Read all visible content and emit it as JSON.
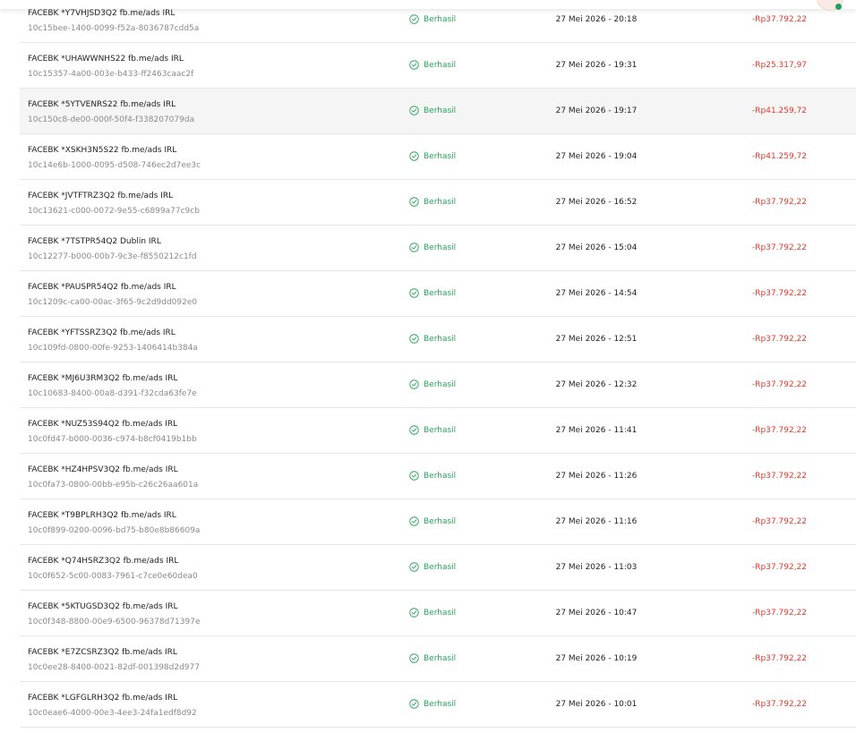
{
  "colors": {
    "success": "#27a55a",
    "negative_amount": "#e0392b",
    "row_highlight": "#f5f5f5",
    "divider": "#e7e7e7"
  },
  "icons": {
    "status": "check-circle-icon"
  },
  "transactions": [
    {
      "description": "FACEBK *Y7VHJSD3Q2 fb.me/ads IRL",
      "id": "10c15bee-1400-0099-f52a-8036787cdd5a",
      "status": "Berhasil",
      "datetime": "27 Mei 2026 - 20:18",
      "amount": "-Rp37.792,22"
    },
    {
      "description": "FACEBK *UHAWWNHS22 fb.me/ads IRL",
      "id": "10c15357-4a00-003e-b433-ff2463caac2f",
      "status": "Berhasil",
      "datetime": "27 Mei 2026 - 19:31",
      "amount": "-Rp25.317,97"
    },
    {
      "description": "FACEBK *5YTVENRS22 fb.me/ads IRL",
      "id": "10c150c8-de00-000f-50f4-f338207079da",
      "status": "Berhasil",
      "datetime": "27 Mei 2026 - 19:17",
      "amount": "-Rp41.259,72"
    },
    {
      "description": "FACEBK *XSKH3N5S22 fb.me/ads IRL",
      "id": "10c14e6b-1000-0095-d508-746ec2d7ee3c",
      "status": "Berhasil",
      "datetime": "27 Mei 2026 - 19:04",
      "amount": "-Rp41.259,72"
    },
    {
      "description": "FACEBK *JVTFTRZ3Q2 fb.me/ads IRL",
      "id": "10c13621-c000-0072-9e55-c6899a77c9cb",
      "status": "Berhasil",
      "datetime": "27 Mei 2026 - 16:52",
      "amount": "-Rp37.792,22"
    },
    {
      "description": "FACEBK *7TSTPR54Q2 Dublin IRL",
      "id": "10c12277-b000-00b7-9c3e-f8550212c1fd",
      "status": "Berhasil",
      "datetime": "27 Mei 2026 - 15:04",
      "amount": "-Rp37.792,22"
    },
    {
      "description": "FACEBK *PAUSPR54Q2 fb.me/ads IRL",
      "id": "10c1209c-ca00-00ac-3f65-9c2d9dd092e0",
      "status": "Berhasil",
      "datetime": "27 Mei 2026 - 14:54",
      "amount": "-Rp37.792,22"
    },
    {
      "description": "FACEBK *YFTSSRZ3Q2 fb.me/ads IRL",
      "id": "10c109fd-0800-00fe-9253-1406414b384a",
      "status": "Berhasil",
      "datetime": "27 Mei 2026 - 12:51",
      "amount": "-Rp37.792,22"
    },
    {
      "description": "FACEBK *MJ6U3RM3Q2 fb.me/ads IRL",
      "id": "10c10683-8400-00a8-d391-f32cda63fe7e",
      "status": "Berhasil",
      "datetime": "27 Mei 2026 - 12:32",
      "amount": "-Rp37.792,22"
    },
    {
      "description": "FACEBK *NUZ53S94Q2 fb.me/ads IRL",
      "id": "10c0fd47-b000-0036-c974-b8cf0419b1bb",
      "status": "Berhasil",
      "datetime": "27 Mei 2026 - 11:41",
      "amount": "-Rp37.792,22"
    },
    {
      "description": "FACEBK *HZ4HPSV3Q2 fb.me/ads IRL",
      "id": "10c0fa73-0800-00bb-e95b-c26c26aa601a",
      "status": "Berhasil",
      "datetime": "27 Mei 2026 - 11:26",
      "amount": "-Rp37.792,22"
    },
    {
      "description": "FACEBK *T9BPLRH3Q2 fb.me/ads IRL",
      "id": "10c0f899-0200-0096-bd75-b80e8b86609a",
      "status": "Berhasil",
      "datetime": "27 Mei 2026 - 11:16",
      "amount": "-Rp37.792,22"
    },
    {
      "description": "FACEBK *Q74HSRZ3Q2 fb.me/ads IRL",
      "id": "10c0f652-5c00-0083-7961-c7ce0e60dea0",
      "status": "Berhasil",
      "datetime": "27 Mei 2026 - 11:03",
      "amount": "-Rp37.792,22"
    },
    {
      "description": "FACEBK *5KTUGSD3Q2 fb.me/ads IRL",
      "id": "10c0f348-8800-00e9-6500-96378d71397e",
      "status": "Berhasil",
      "datetime": "27 Mei 2026 - 10:47",
      "amount": "-Rp37.792,22"
    },
    {
      "description": "FACEBK *E7ZCSRZ3Q2 fb.me/ads IRL",
      "id": "10c0ee28-8400-0021-82df-001398d2d977",
      "status": "Berhasil",
      "datetime": "27 Mei 2026 - 10:19",
      "amount": "-Rp37.792,22"
    },
    {
      "description": "FACEBK *LGFGLRH3Q2 fb.me/ads IRL",
      "id": "10c0eae6-4000-00e3-4ee3-24fa1edf8d92",
      "status": "Berhasil",
      "datetime": "27 Mei 2026 - 10:01",
      "amount": "-Rp37.792,22"
    }
  ]
}
